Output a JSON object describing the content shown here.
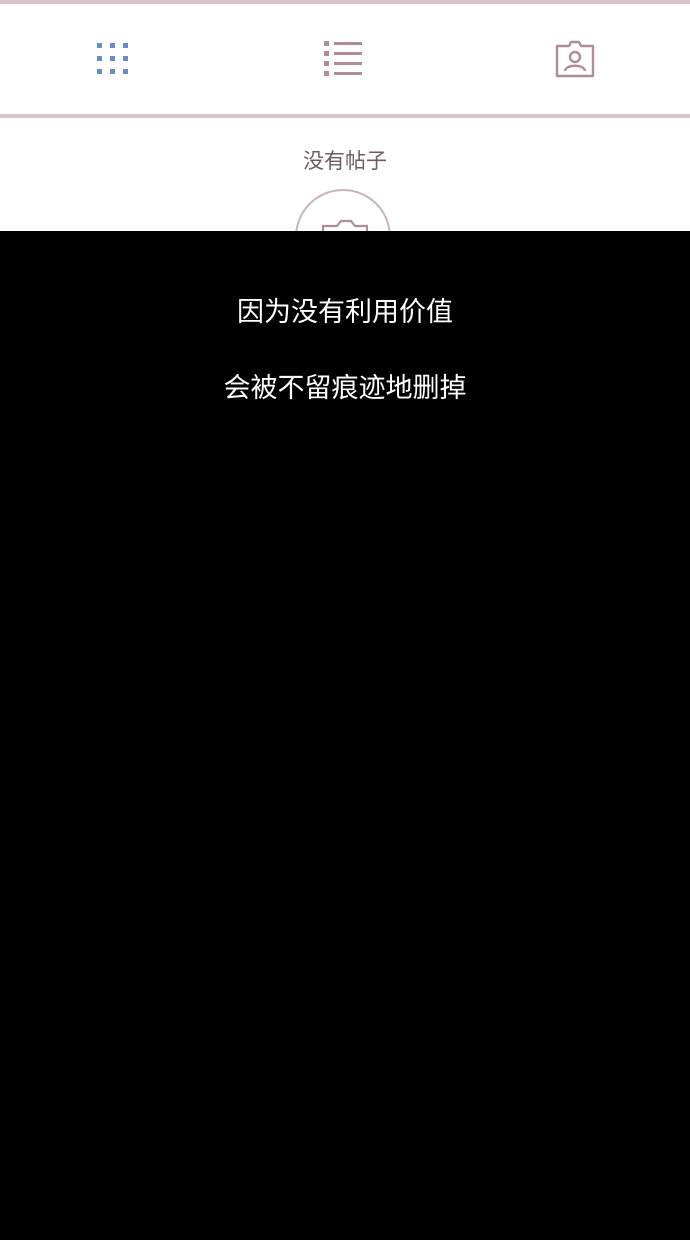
{
  "tabbar": {
    "tabs": [
      {
        "icon": "grid-icon",
        "active": true
      },
      {
        "icon": "list-icon",
        "active": false
      },
      {
        "icon": "tagged-person-icon",
        "active": false
      }
    ],
    "active_color": "#6b8cc7",
    "inactive_color": "#b08d93"
  },
  "profile_feed": {
    "empty_title": "没有帖子",
    "placeholder_icon": "camera-icon"
  },
  "captions": {
    "line1": "因为没有利用价值",
    "line2": "会被不留痕迹地删掉"
  }
}
